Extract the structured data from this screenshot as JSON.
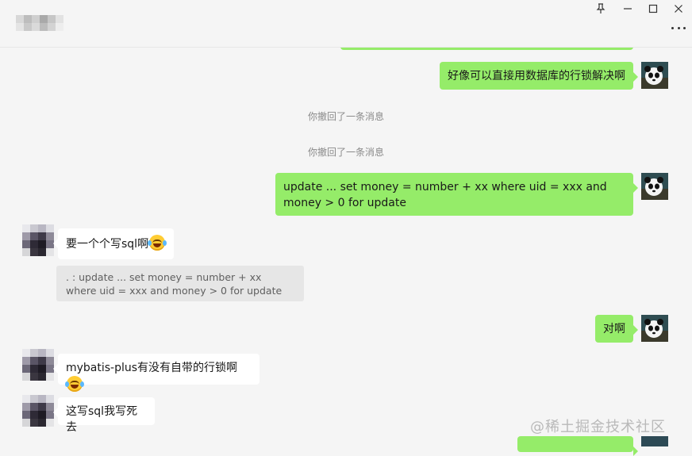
{
  "window": {
    "pin_icon": "pin-icon",
    "minimize_icon": "minimize-icon",
    "maximize_icon": "maximize-icon",
    "close_icon": "close-icon",
    "more_icon": "more-dots-icon"
  },
  "messages": {
    "m1": "好像可以直接用数据库的行锁解决啊",
    "recall1": "你撤回了一条消息",
    "recall2": "你撤回了一条消息",
    "m2": "update ... set money = number + xx where uid = xxx and money > 0 for update",
    "m3": "要一个个写sql啊",
    "quote": ". : update ... set money = number + xx where uid = xxx and money > 0 for update",
    "m4": "对啊",
    "m5": "mybatis-plus有没有自带的行锁啊",
    "m6": "这写sql我写死去"
  },
  "watermark": "@稀土掘金技术社区",
  "colors": {
    "bg": "#f5f5f5",
    "bubble_self": "#95ec69",
    "bubble_other": "#ffffff",
    "quote_bg": "#e6e6e6"
  }
}
